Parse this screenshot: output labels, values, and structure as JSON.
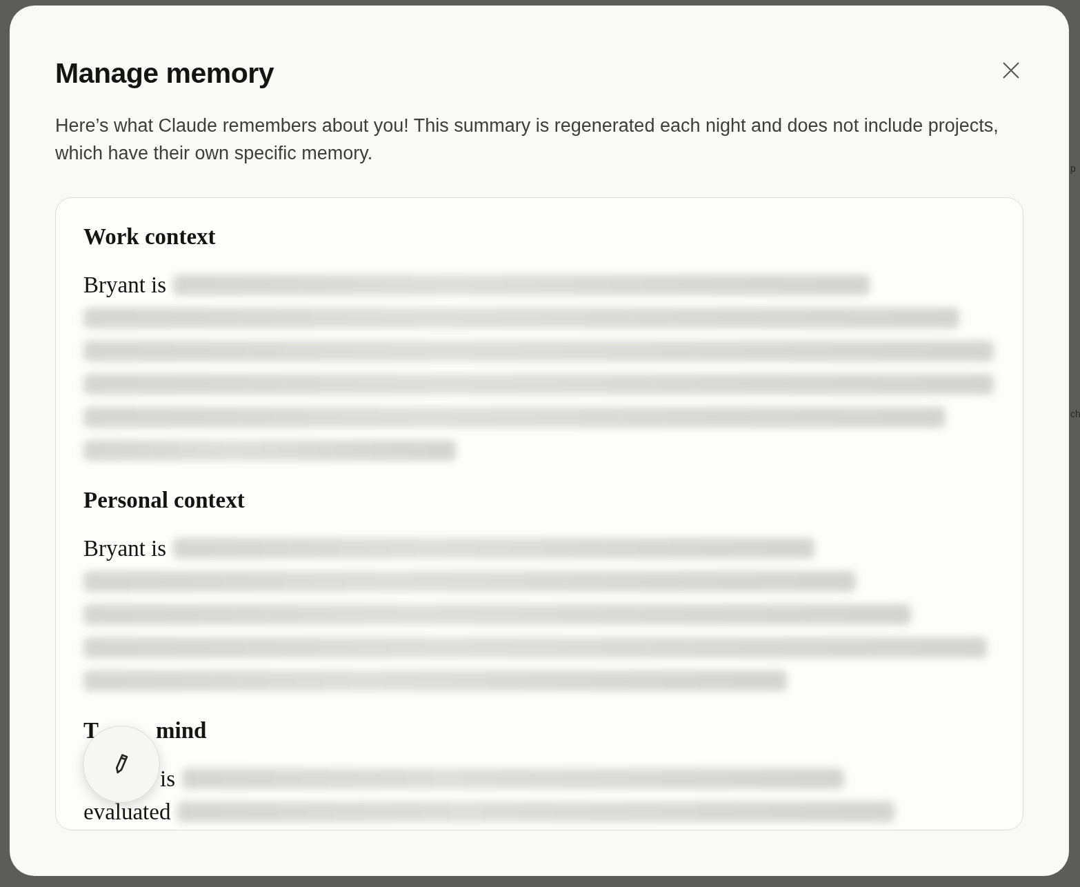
{
  "dialog": {
    "title": "Manage memory",
    "description": "Here’s what Claude remembers about you! This summary is regenerated each night and does not include projects, which have their own specific memory."
  },
  "sections": [
    {
      "heading": "Work context",
      "lines": [
        {
          "text": "Bryant is",
          "blurred": true
        },
        {
          "blurred": true
        },
        {
          "blurred": true
        },
        {
          "blurred": true
        },
        {
          "blurred": true
        },
        {
          "blurred": true
        }
      ]
    },
    {
      "heading": "Personal context",
      "lines": [
        {
          "text": "Bryant is",
          "blurred": true
        },
        {
          "blurred": true
        },
        {
          "blurred": true
        },
        {
          "blurred": true
        },
        {
          "blurred": true
        }
      ]
    },
    {
      "heading_parts": [
        "T",
        "mind"
      ],
      "lines": [
        {
          "text": "is",
          "blurred": true
        },
        {
          "text": "evaluated",
          "blurred": true
        }
      ]
    }
  ],
  "edit_button": {
    "kind": "pencil"
  },
  "backdrop_texts": [
    "p",
    "ch"
  ]
}
